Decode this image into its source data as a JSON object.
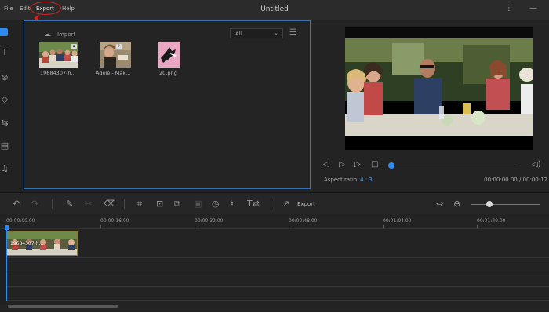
{
  "window": {
    "title": "Untitled"
  },
  "menu": {
    "file": "File",
    "edit": "Edit",
    "export": "Export",
    "help": "Help"
  },
  "window_controls": "⋮ —",
  "media": {
    "import_label": "Import",
    "filter": {
      "selected": "All"
    },
    "items": [
      {
        "caption": "19684307-h..."
      },
      {
        "caption": "Adele - Mak..."
      },
      {
        "caption": "20.png"
      }
    ]
  },
  "preview": {
    "aspect_label": "Aspect ratio",
    "aspect_value": "4 : 3",
    "time": "00:00:00.00 / 00:00:12"
  },
  "toolbar": {
    "export_label": "Export"
  },
  "ruler": {
    "labels": [
      "00:00:00.00",
      "00:00:16.00",
      "00:00:32.00",
      "00:00:48.00",
      "00:01:04.00",
      "00:01:20.00"
    ]
  },
  "timeline": {
    "clip_label": "19684307-h..."
  },
  "colors": {
    "accent": "#2f8bf0",
    "annotation": "#d32020",
    "panel_border": "#3a6fb0"
  }
}
